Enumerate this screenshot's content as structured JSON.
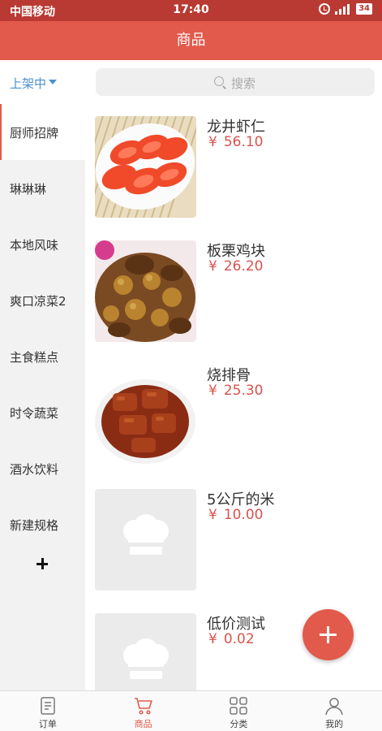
{
  "status_bar": {
    "carrier": "中国移动",
    "time": "17:40",
    "battery": "34"
  },
  "header": {
    "title": "商品"
  },
  "filter": {
    "label": "上架中"
  },
  "search": {
    "placeholder": "搜索"
  },
  "categories": [
    {
      "label": "厨师招牌",
      "active": true
    },
    {
      "label": "琳琳琳",
      "active": false
    },
    {
      "label": "本地风味",
      "active": false
    },
    {
      "label": "爽口凉菜2",
      "active": false
    },
    {
      "label": "主食糕点",
      "active": false
    },
    {
      "label": "时令蔬菜",
      "active": false
    },
    {
      "label": "酒水饮料",
      "active": false
    },
    {
      "label": "新建规格",
      "active": false
    }
  ],
  "currency_symbol": "¥",
  "products": [
    {
      "name": "龙井虾仁",
      "price": "56.10",
      "image": "tomato-dish"
    },
    {
      "name": "板栗鸡块",
      "price": "26.20",
      "image": "chestnut-chicken"
    },
    {
      "name": "烧排骨",
      "price": "25.30",
      "image": "braised-ribs"
    },
    {
      "name": "5公斤的米",
      "price": "10.00",
      "image": "placeholder-chef-hat"
    },
    {
      "name": "低价测试",
      "price": "0.02",
      "image": "placeholder-chef-hat"
    }
  ],
  "tabs": [
    {
      "label": "订单",
      "icon": "order-icon",
      "active": false
    },
    {
      "label": "商品",
      "icon": "cart-icon",
      "active": true
    },
    {
      "label": "分类",
      "icon": "category-grid-icon",
      "active": false
    },
    {
      "label": "我的",
      "icon": "user-icon",
      "active": false
    }
  ],
  "colors": {
    "brand": "#e25a4c",
    "status_bar": "#b93a33",
    "price": "#d9534f",
    "filter": "#4a90d0"
  }
}
